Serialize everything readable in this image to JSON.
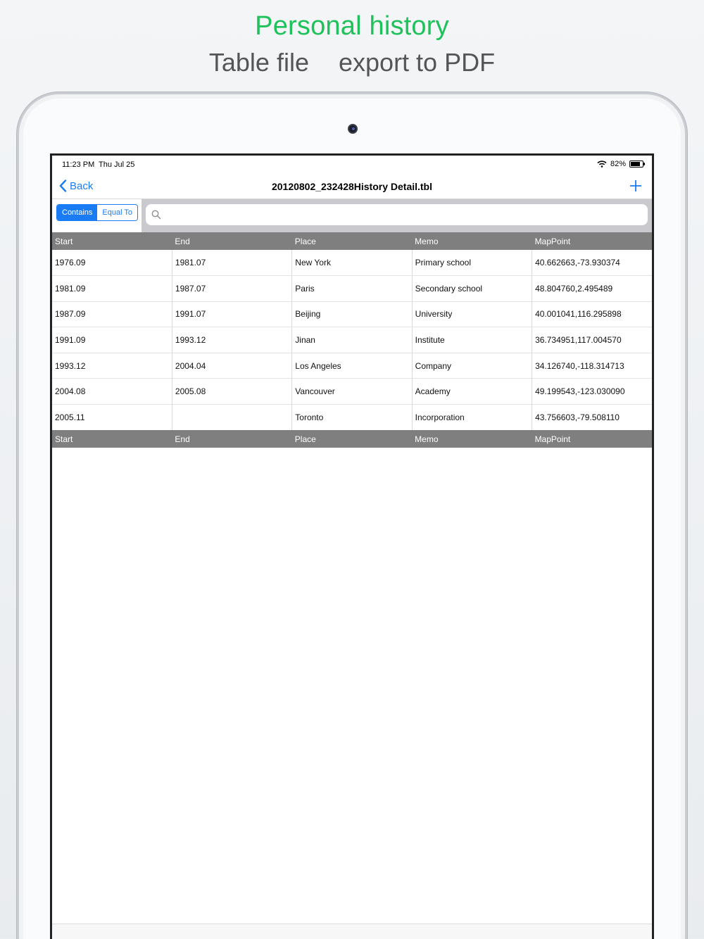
{
  "promo": {
    "headline": "Personal history",
    "sub_left": "Table file",
    "sub_right": "export to PDF"
  },
  "status": {
    "time": "11:23 PM",
    "date": "Thu Jul 25",
    "battery": "82%",
    "battery_level": 0.82
  },
  "nav": {
    "back_label": "Back",
    "title": "20120802_232428History Detail.tbl",
    "add_label": "+"
  },
  "search": {
    "segments": [
      "Contains",
      "Equal To"
    ],
    "active_segment": "Contains",
    "value": "",
    "placeholder": ""
  },
  "table": {
    "columns": [
      "Start",
      "End",
      "Place",
      "Memo",
      "MapPoint"
    ],
    "rows": [
      [
        "1976.09",
        "1981.07",
        "New York",
        "Primary school",
        "40.662663,-73.930374"
      ],
      [
        "1981.09",
        "1987.07",
        "Paris",
        "Secondary school",
        "48.804760,2.495489"
      ],
      [
        "1987.09",
        "1991.07",
        "Beijing",
        "University",
        "40.001041,116.295898"
      ],
      [
        "1991.09",
        "1993.12",
        "Jinan",
        "Institute",
        "36.734951,117.004570"
      ],
      [
        "1993.12",
        "2004.04",
        "Los Angeles",
        "Company",
        "34.126740,-118.314713"
      ],
      [
        "2004.08",
        "2005.08",
        "Vancouver",
        "Academy",
        "49.199543,-123.030090"
      ],
      [
        "2005.11",
        "",
        "Toronto",
        "Incorporation",
        "43.756603,-79.508110"
      ]
    ]
  },
  "colors": {
    "accent": "#1a7cf5",
    "headline": "#1fc15a",
    "header_bg": "#7f7f7f"
  }
}
